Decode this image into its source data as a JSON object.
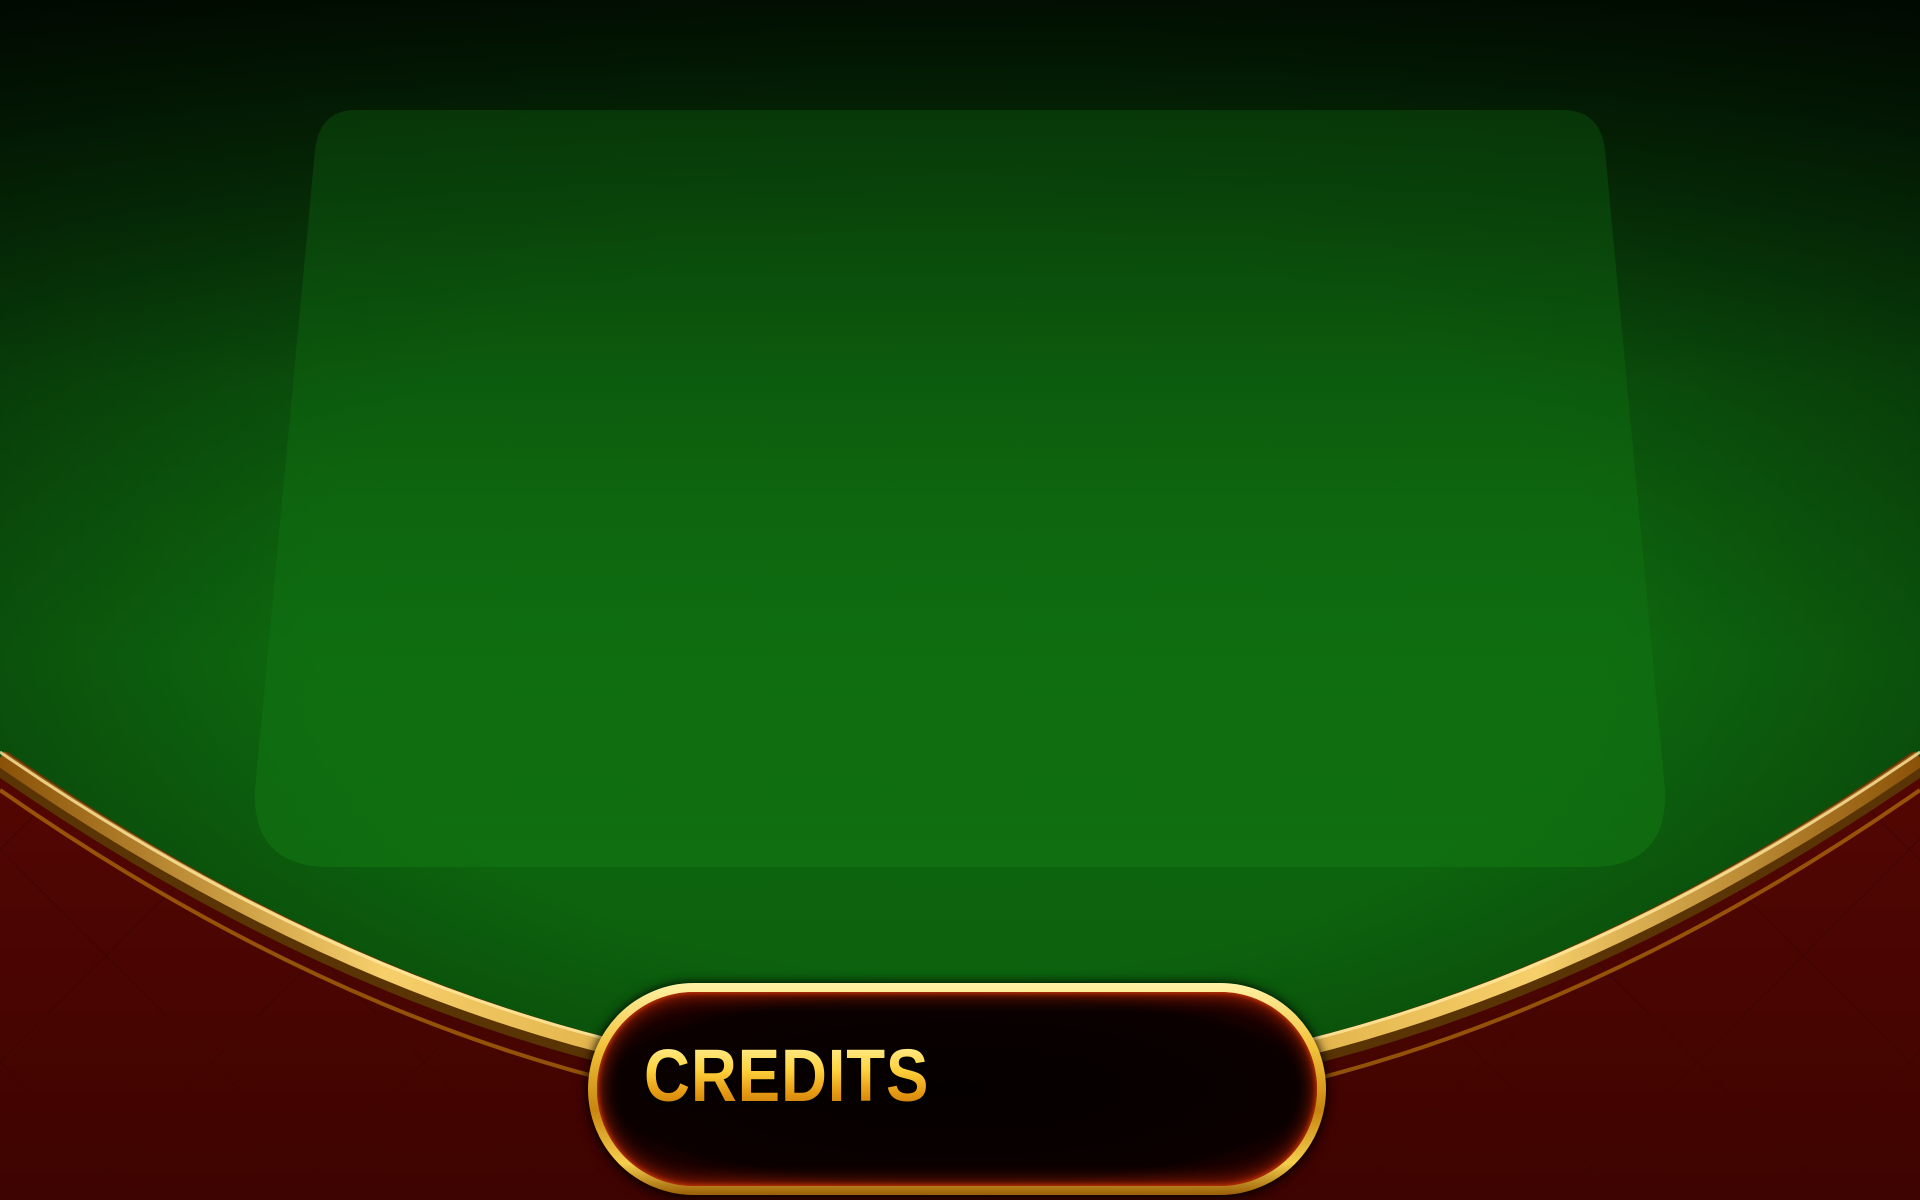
{
  "table": {
    "felt_color": "#0d6a0f",
    "felt_edge_color": "#042d06",
    "rail_color": "#6e0a03",
    "trim_color": "#c8860f"
  },
  "credits": {
    "label": "CREDITS",
    "value": ""
  }
}
